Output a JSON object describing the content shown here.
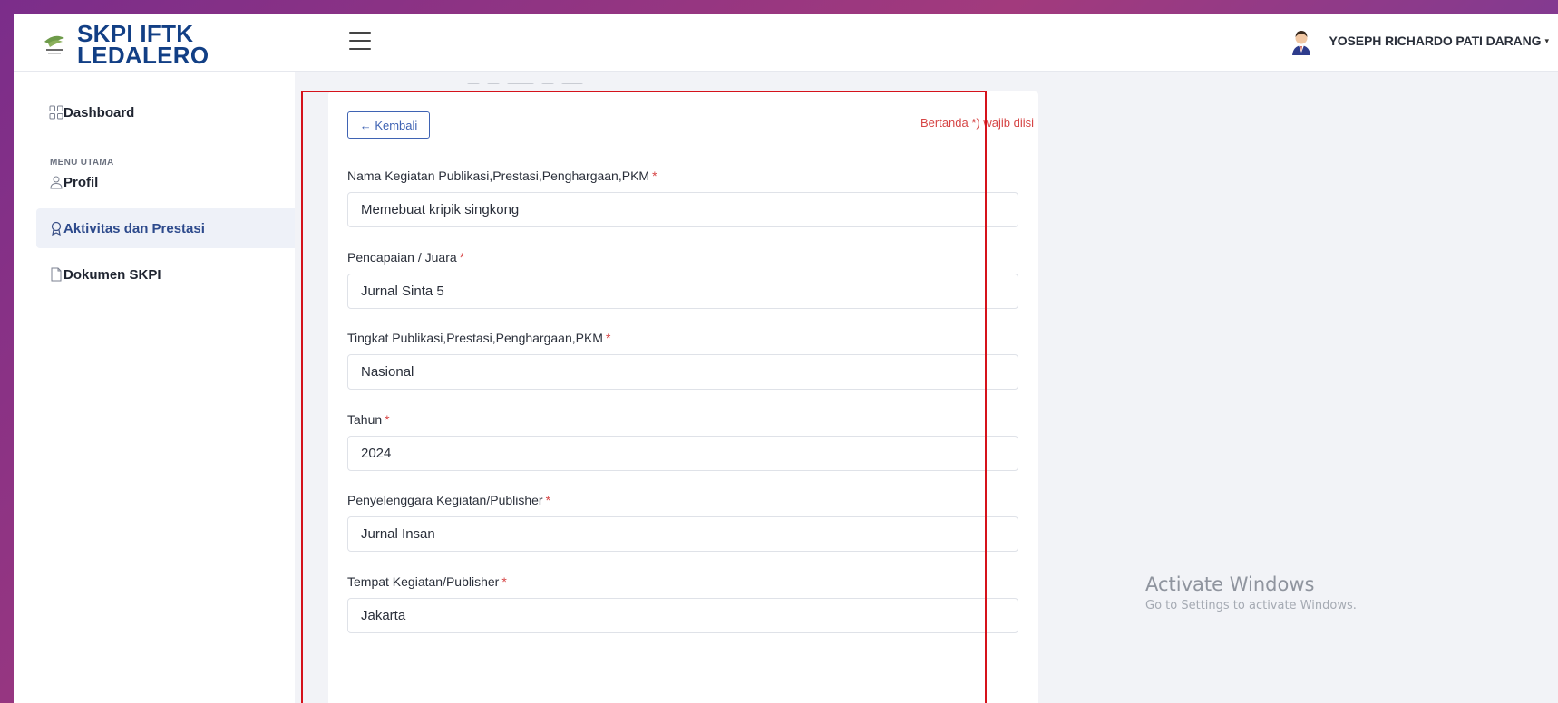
{
  "header": {
    "brand_line1": "SKPI IFTK",
    "brand_line2": "LEDALERO",
    "user_name": "YOSEPH RICHARDO PATI DARANG",
    "caret": "▾"
  },
  "sidebar": {
    "section_label": "MENU UTAMA",
    "items": [
      {
        "label": "Dashboard",
        "icon": "grid-icon"
      },
      {
        "label": "Profil",
        "icon": "user-icon"
      },
      {
        "label": "Aktivitas dan Prestasi",
        "icon": "award-icon",
        "active": true
      },
      {
        "label": "Dokumen SKPI",
        "icon": "file-icon"
      }
    ]
  },
  "form": {
    "back_label": "← Kembali",
    "required_note": "Bertanda *) wajib diisi",
    "required_mark": "*",
    "fields": [
      {
        "label": "Nama Kegiatan Publikasi,Prestasi,Penghargaan,PKM",
        "value": "Memebuat kripik singkong"
      },
      {
        "label": "Pencapaian / Juara",
        "value": "Jurnal Sinta 5"
      },
      {
        "label": "Tingkat Publikasi,Prestasi,Penghargaan,PKM",
        "value": "Nasional"
      },
      {
        "label": "Tahun",
        "value": "2024"
      },
      {
        "label": "Penyelenggara Kegiatan/Publisher",
        "value": "Jurnal Insan"
      },
      {
        "label": "Tempat Kegiatan/Publisher",
        "value": "Jakarta"
      }
    ]
  },
  "watermark": {
    "title": "Activate Windows",
    "subtitle": "Go to Settings to activate Windows."
  },
  "colors": {
    "brand": "#123f85",
    "accent": "#3f63b3",
    "required": "#d64545",
    "highlight": "#d5121b"
  }
}
